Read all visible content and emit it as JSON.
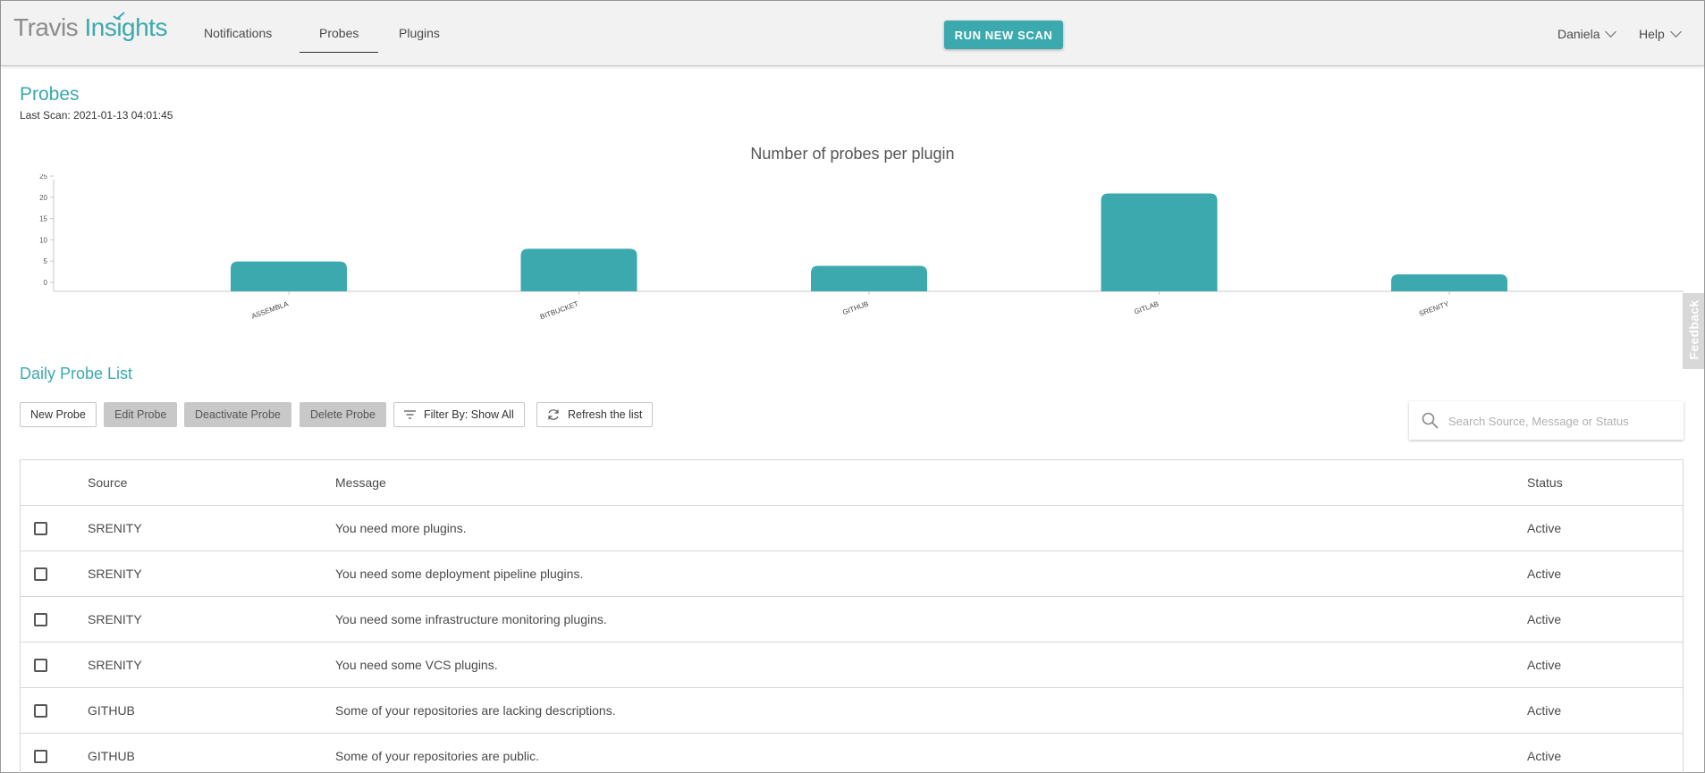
{
  "app": {
    "logo_part1": "Travis",
    "logo_part2": "Insights",
    "brand_color": "#3ba9ae"
  },
  "nav": {
    "items": [
      {
        "label": "Notifications"
      },
      {
        "label": "Probes"
      },
      {
        "label": "Plugins"
      }
    ],
    "active": "Probes"
  },
  "header": {
    "scan_button": "RUN NEW SCAN",
    "user": "Daniela",
    "help": "Help"
  },
  "page": {
    "title": "Probes",
    "last_scan": "Last Scan: 2021-01-13 04:01:45"
  },
  "chart_data": {
    "type": "bar",
    "title": "Number of probes per plugin",
    "categories": [
      "ASSEMBLA",
      "BITBUCKET",
      "GITHUB",
      "GITLAB",
      "SRENITY"
    ],
    "values": [
      7,
      10,
      6,
      23,
      4
    ],
    "ylim": [
      0,
      25
    ],
    "yticks": [
      0,
      5,
      10,
      15,
      20,
      25
    ],
    "xlabel": "",
    "ylabel": "",
    "bar_color": "#3ba9ae",
    "grid": false
  },
  "feedback": "Feedback",
  "list": {
    "title": "Daily Probe List",
    "toolbar": {
      "new_probe": "New Probe",
      "edit_probe": "Edit Probe",
      "deactivate_probe": "Deactivate Probe",
      "delete_probe": "Delete Probe",
      "filter": "Filter By: Show All",
      "refresh": "Refresh the list"
    },
    "search_placeholder": "Search Source, Message or Status",
    "columns": {
      "source": "Source",
      "message": "Message",
      "status": "Status"
    },
    "rows": [
      {
        "source": "SRENITY",
        "message": "You need more plugins.",
        "status": "Active"
      },
      {
        "source": "SRENITY",
        "message": "You need some deployment pipeline plugins.",
        "status": "Active"
      },
      {
        "source": "SRENITY",
        "message": "You need some infrastructure monitoring plugins.",
        "status": "Active"
      },
      {
        "source": "SRENITY",
        "message": "You need some VCS plugins.",
        "status": "Active"
      },
      {
        "source": "GITHUB",
        "message": "Some of your repositories are lacking descriptions.",
        "status": "Active"
      },
      {
        "source": "GITHUB",
        "message": "Some of your repositories are public.",
        "status": "Active"
      }
    ]
  }
}
